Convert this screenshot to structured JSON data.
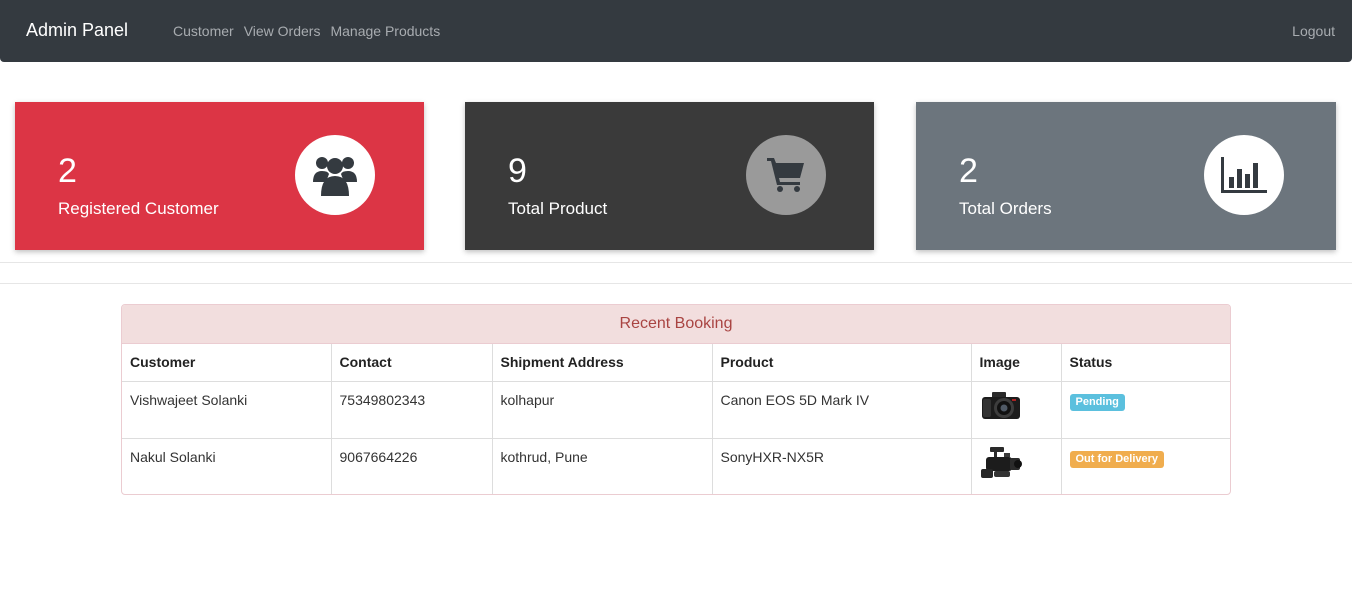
{
  "navbar": {
    "brand": "Admin Panel",
    "links": [
      "Customer",
      "View Orders",
      "Manage Products"
    ],
    "logout": "Logout"
  },
  "stats": [
    {
      "count": "2",
      "label": "Registered Customer",
      "icon": "users-icon",
      "color": "#dc3545"
    },
    {
      "count": "9",
      "label": "Total Product",
      "icon": "shopping-cart-icon",
      "color": "#3a3a3a"
    },
    {
      "count": "2",
      "label": "Total Orders",
      "icon": "bar-chart-icon",
      "color": "#6c757d"
    }
  ],
  "recent_booking": {
    "title": "Recent Booking",
    "columns": [
      "Customer",
      "Contact",
      "Shipment Address",
      "Product",
      "Image",
      "Status"
    ],
    "rows": [
      {
        "customer": "Vishwajeet Solanki",
        "contact": "75349802343",
        "address": "kolhapur",
        "product": "Canon EOS 5D Mark IV",
        "image": "dslr-camera-image",
        "status": "Pending",
        "status_color": "#5bc0de"
      },
      {
        "customer": "Nakul Solanki",
        "contact": "9067664226",
        "address": "kothrud, Pune",
        "product": "SonyHXR-NX5R",
        "image": "camcorder-image",
        "status": "Out for Delivery",
        "status_color": "#f0ad4e"
      }
    ]
  }
}
